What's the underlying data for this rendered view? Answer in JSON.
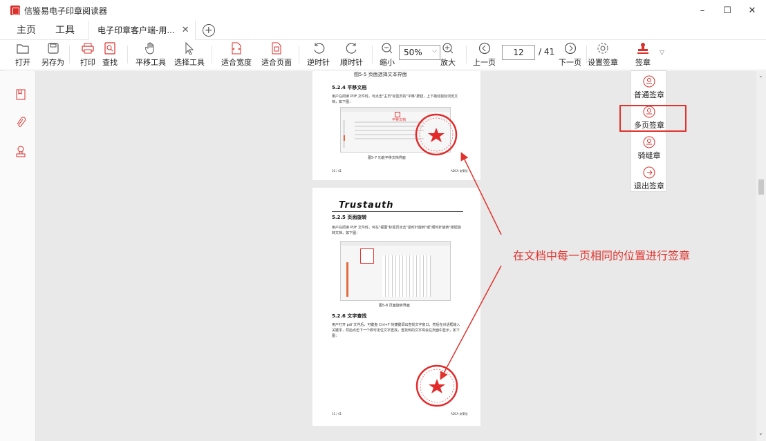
{
  "window": {
    "title": "信鉴易电子印章阅读器",
    "controls": {
      "minimize": "–",
      "maximize": "☐",
      "close": "✕"
    }
  },
  "tabs": {
    "home": "主页",
    "tools": "工具",
    "document": "电子印章客户端-用...",
    "close": "✕",
    "add": "+"
  },
  "toolbar": {
    "open": "打开",
    "save_as": "另存为",
    "print": "打印",
    "find": "查找",
    "pan_tool": "平移工具",
    "select_tool": "选择工具",
    "fit_width": "适合宽度",
    "fit_page": "适合页面",
    "rotate_ccw": "逆时针",
    "rotate_cw": "顺时针",
    "zoom_out": "缩小",
    "zoom_value": "50%",
    "zoom_in": "放大",
    "prev_page": "上一页",
    "page_current": "12",
    "page_total": "/ 41",
    "next_page": "下一页",
    "sign_settings": "设置签章",
    "sign": "签章"
  },
  "sign_menu": {
    "items": [
      "普通签章",
      "多页签章",
      "骑缝章",
      "退出签章"
    ],
    "highlighted": "多页签章"
  },
  "document": {
    "page1": {
      "caption_top": "图5-5 页面选择文本界面",
      "section": "5.2.4 平移文档",
      "body": "用户在阅读 PDF 文件时，可点击\"主页\"标签页的\"平移\"按钮，上下拖动鼠标浏览文档，如下图：",
      "fig_label": "平移文档",
      "caption": "图5-7 功能平移文档界面",
      "footer_left": "10 / 41",
      "footer_right": "ADCA 安策信"
    },
    "page2": {
      "logo": "Trustauth",
      "section_rotate": "5.2.5 页面旋转",
      "body_rotate": "用户在阅读 PDF 文件时，可在\"视图\"标签页点击\"逆时针旋转\"或\"顺时针旋转\"按钮旋转文档，如下图：",
      "caption_rotate": "图5-8 页面旋转界面",
      "section_search": "5.2.6 文字查找",
      "body_search": "用户打开 pdf 文件后，可键盘 Ctrl+F 快捷键调出查找文字窗口，然后在对话框输入关键字，然后点击下一个即可定位文字查找，查找到的文字将会在页面中显示，如下图：",
      "footer_left": "11 / 41",
      "footer_right": "ADCA 安策信"
    }
  },
  "annotation": "在文档中每一页相同的位置进行签章",
  "colors": {
    "accent_red": "#e1322d",
    "seal_red": "#e32a2a",
    "toolbar_icon": "#555555"
  }
}
